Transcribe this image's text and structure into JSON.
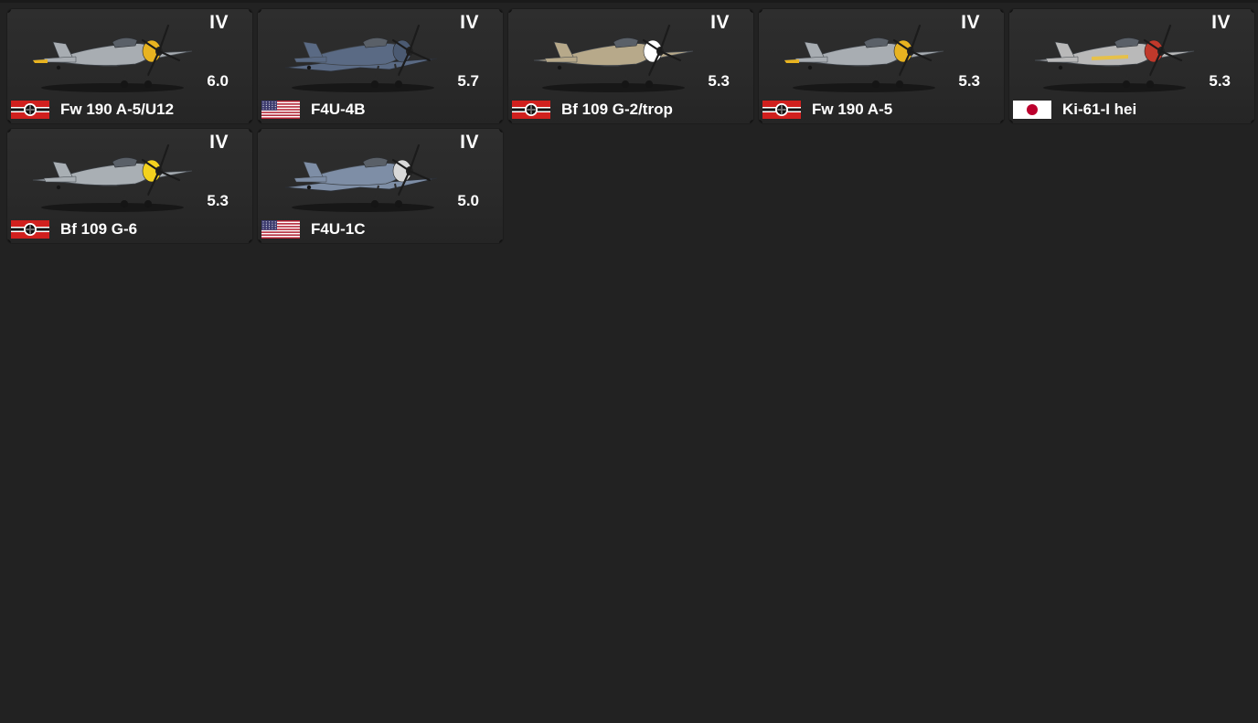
{
  "vehicles": [
    {
      "rank": "IV",
      "br": "6.0",
      "name": "Fw 190 A-5/U12",
      "nation": "germany",
      "icon": "fw190-aircraft-icon",
      "accent": "#e8b320",
      "body": "#a8adb2"
    },
    {
      "rank": "IV",
      "br": "5.7",
      "name": "F4U-4B",
      "nation": "usa",
      "icon": "f4u-aircraft-icon",
      "accent": "#4b5a72",
      "body": "#5a6a84"
    },
    {
      "rank": "IV",
      "br": "5.3",
      "name": "Bf 109 G-2/trop",
      "nation": "germany",
      "icon": "bf109-aircraft-icon",
      "accent": "#ffffff",
      "body": "#b7a98a"
    },
    {
      "rank": "IV",
      "br": "5.3",
      "name": "Fw 190 A-5",
      "nation": "germany",
      "icon": "fw190-aircraft-icon",
      "accent": "#e8b320",
      "body": "#a8adb2"
    },
    {
      "rank": "IV",
      "br": "5.3",
      "name": "Ki-61-I hei",
      "nation": "japan",
      "icon": "ki61-aircraft-icon",
      "accent": "#c0392b",
      "body": "#b9b9b9"
    },
    {
      "rank": "IV",
      "br": "5.3",
      "name": "Bf 109 G-6",
      "nation": "germany",
      "icon": "bf109-aircraft-icon",
      "accent": "#f4d21e",
      "body": "#a9afb4"
    },
    {
      "rank": "IV",
      "br": "5.0",
      "name": "F4U-1C",
      "nation": "usa",
      "icon": "f4u-aircraft-icon",
      "accent": "#d9d9d9",
      "body": "#7e8ea6"
    }
  ],
  "flags": {
    "germany": "germany-flag-icon",
    "usa": "usa-flag-icon",
    "japan": "japan-flag-icon"
  }
}
